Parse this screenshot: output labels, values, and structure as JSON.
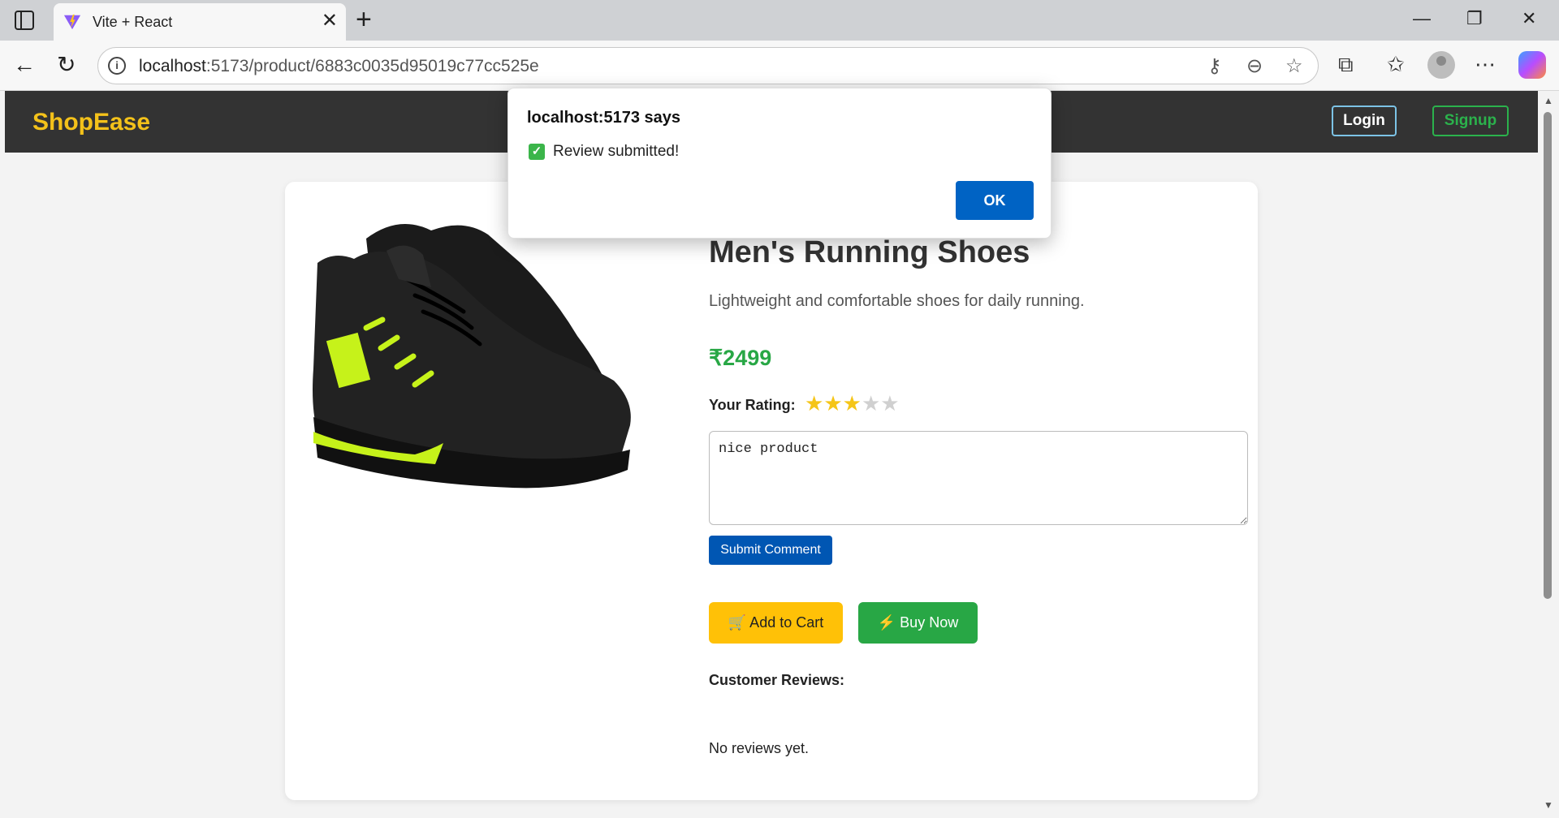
{
  "browser": {
    "tab_title": "Vite + React",
    "url_host": "localhost",
    "url_path": ":5173/product/6883c0035d95019c77cc525e"
  },
  "navbar": {
    "brand": "ShopEase",
    "login_label": "Login",
    "signup_label": "Signup"
  },
  "product": {
    "title": "Men's Running Shoes",
    "description": "Lightweight and comfortable shoes for daily running.",
    "price": "₹2499",
    "rating_label": "Your Rating:",
    "rating_value": 3,
    "rating_max": 5,
    "review_text": "nice product",
    "submit_label": "Submit Comment",
    "cart_label": "🛒 Add to Cart",
    "buy_label": "⚡ Buy Now",
    "reviews_heading": "Customer Reviews:",
    "no_reviews": "No reviews yet."
  },
  "dialog": {
    "title": "localhost:5173 says",
    "message": "Review submitted!",
    "ok_label": "OK"
  },
  "colors": {
    "brand": "#f4c21a",
    "navbar_bg": "#333333",
    "price": "#28a745",
    "primary_button": "#0056b3",
    "cart_button": "#ffc107",
    "buy_button": "#28a745",
    "dialog_ok": "#0063c4"
  },
  "icons": {
    "tab_actions": "tab-actions-icon",
    "close_tab": "close-icon",
    "new_tab": "plus-icon",
    "back": "back-arrow-icon",
    "refresh": "refresh-icon",
    "site_info": "info-icon",
    "key": "key-icon",
    "zoom": "zoom-out-icon",
    "favorite": "star-icon",
    "extensions": "puzzle-icon",
    "favorites_bar": "favorites-icon",
    "profile": "profile-icon",
    "more": "more-icon",
    "copilot": "copilot-icon"
  }
}
